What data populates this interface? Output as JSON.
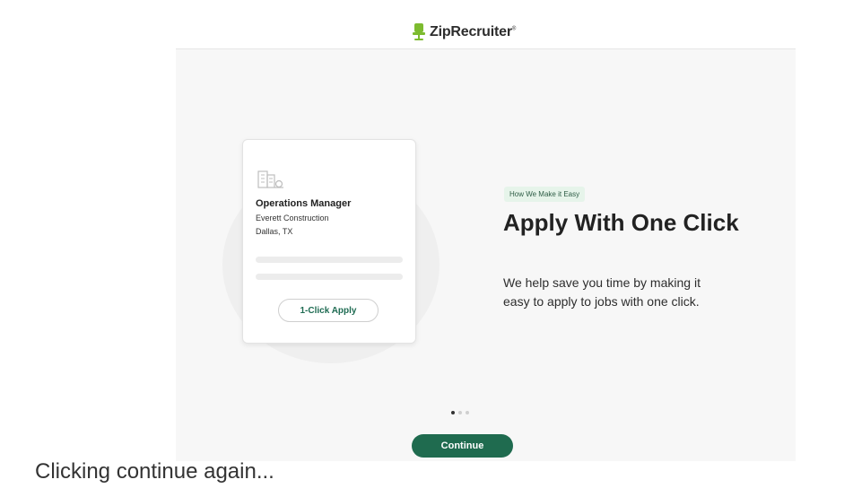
{
  "brand": {
    "name": "ZipRecruiter",
    "trademark": "®",
    "logo_icon": "chair-icon",
    "icon_color": "#7dbb2f"
  },
  "card": {
    "icon": "building-icon",
    "job_title": "Operations Manager",
    "company": "Everett Construction",
    "location": "Dallas, TX",
    "apply_button_label": "1-Click Apply"
  },
  "content": {
    "badge": "How We Make it Easy",
    "heading": "Apply With One Click",
    "description": "We help save you time by making it easy to apply to jobs with one click."
  },
  "pagination": {
    "total": 3,
    "active_index": 0
  },
  "continue_button_label": "Continue",
  "caption": "Clicking continue again...",
  "colors": {
    "accent": "#1f6b4f",
    "badge_bg": "#e6f4ea",
    "panel_bg": "#f7f7f7"
  }
}
